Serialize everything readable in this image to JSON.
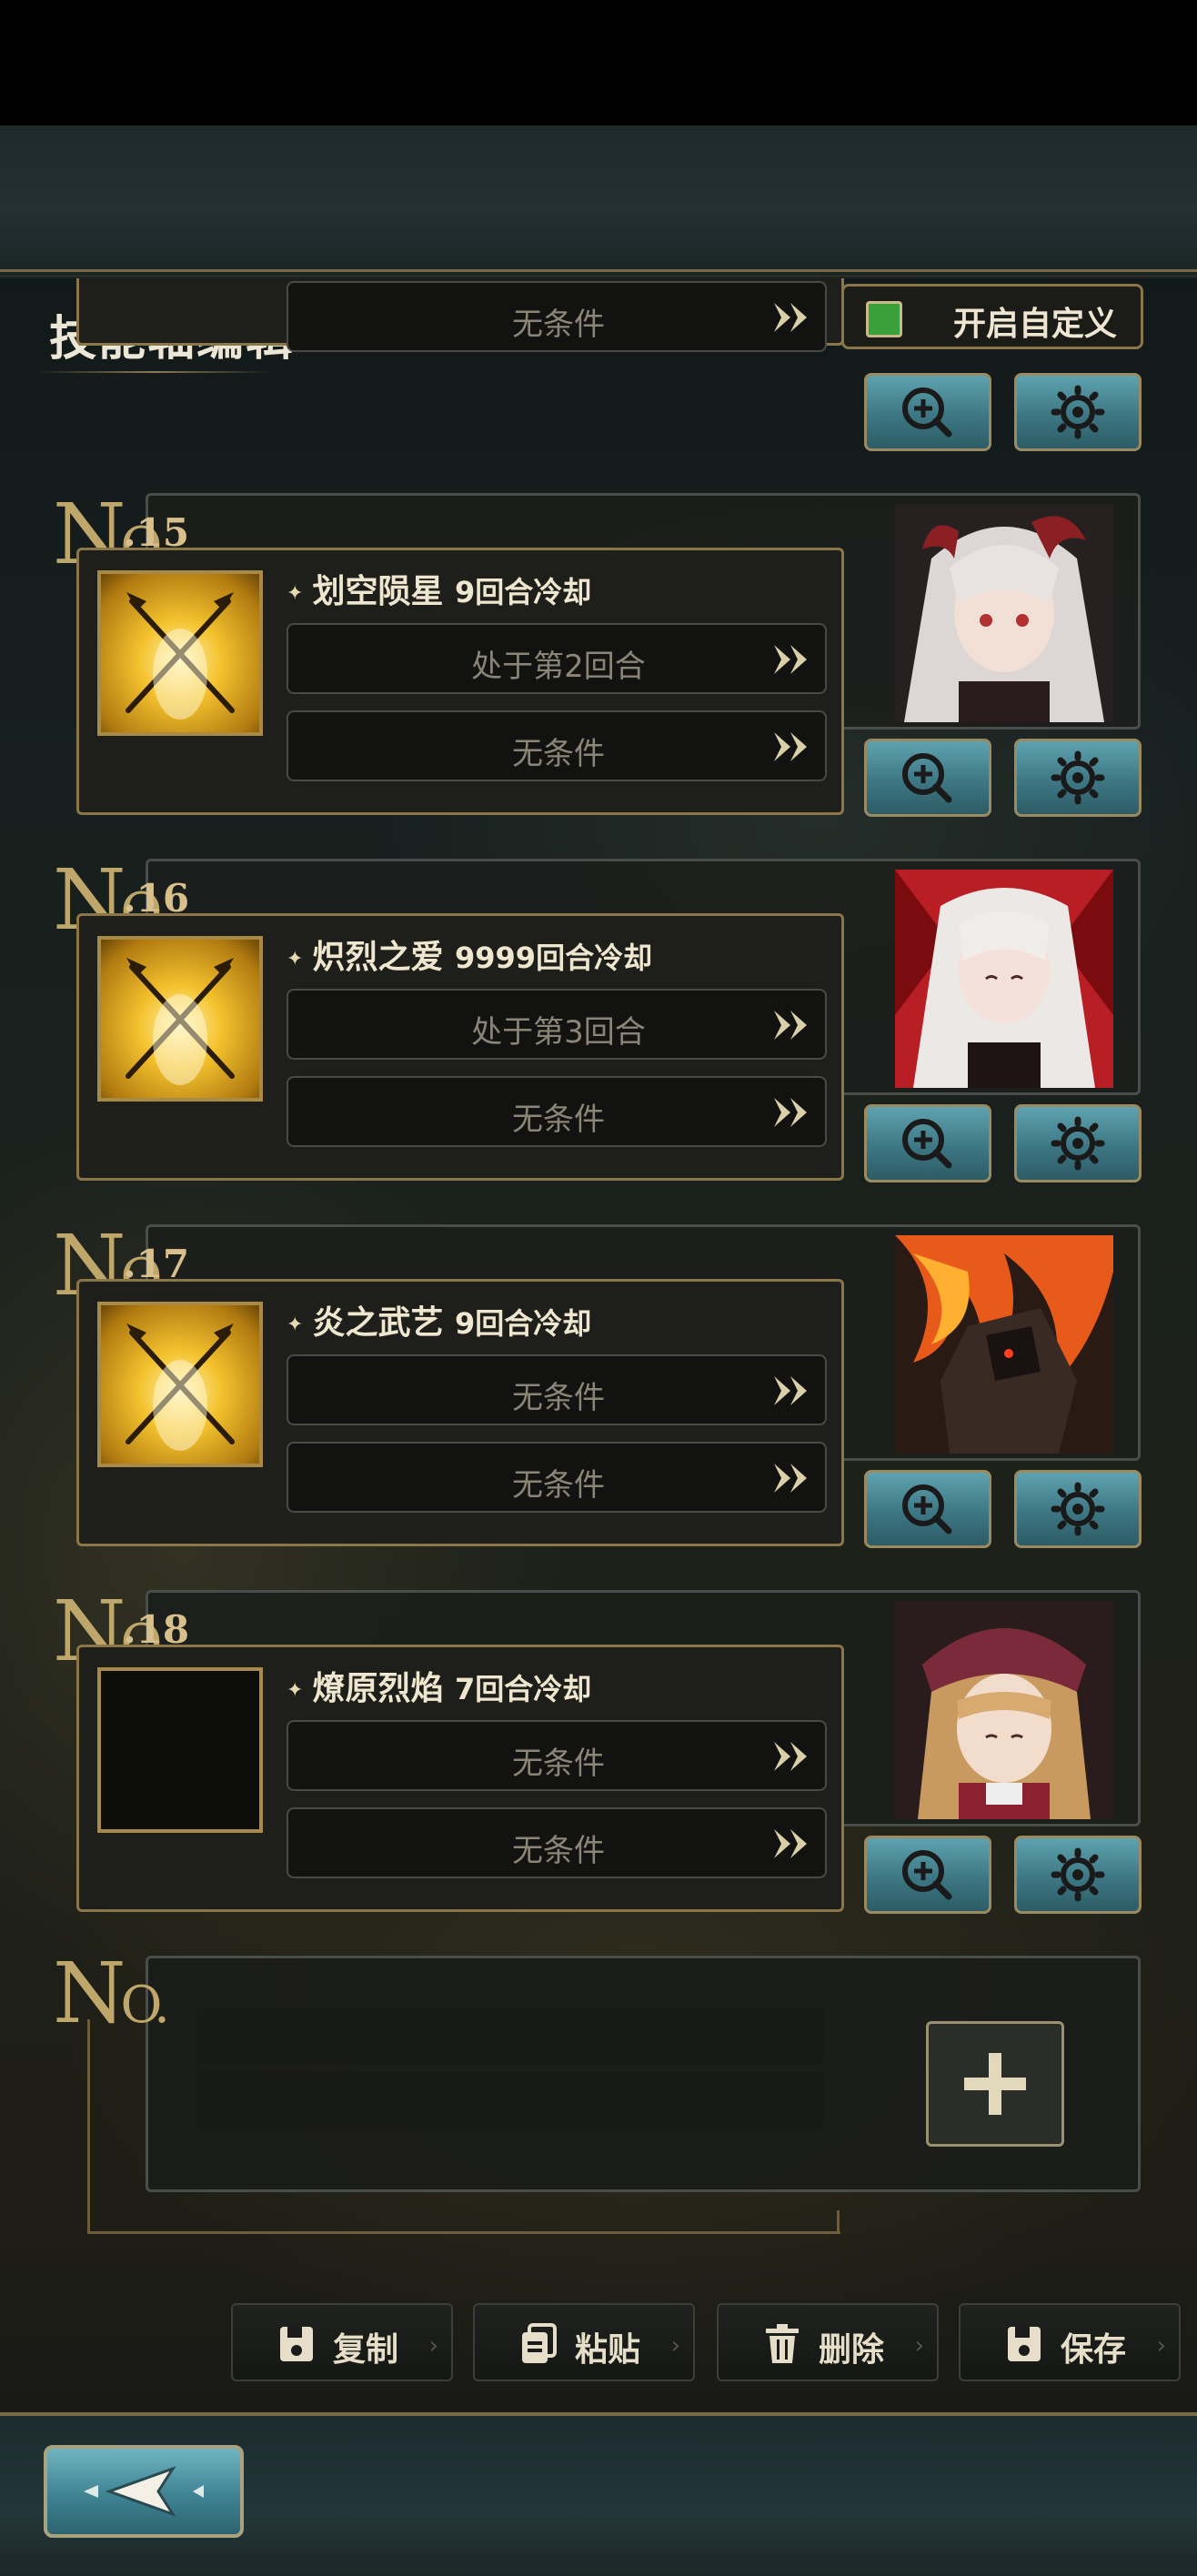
{
  "header": {
    "title": "技能轴编辑",
    "custom_toggle_label": "开启自定义",
    "custom_toggle_on": true
  },
  "colors": {
    "accent_gold": "#bfa66a",
    "toggle_green": "#3aa03a",
    "button_teal": "#3d7784"
  },
  "entries": [
    {
      "no": "",
      "skill": "",
      "conditions": [
        "无条件"
      ],
      "partial": true
    },
    {
      "no": ".15",
      "skill": "划空陨星",
      "cooldown": "9回合冷却",
      "conditions": [
        "处于第2回合",
        "无条件"
      ]
    },
    {
      "no": ".16",
      "skill": "炽烈之爱",
      "cooldown": "9999回合冷却",
      "conditions": [
        "处于第3回合",
        "无条件"
      ]
    },
    {
      "no": ".17",
      "skill": "炎之武艺",
      "cooldown": "9回合冷却",
      "conditions": [
        "无条件",
        "无条件"
      ]
    },
    {
      "no": ".18",
      "skill": "燎原烈焰",
      "cooldown": "7回合冷却",
      "conditions": [
        "无条件",
        "无条件"
      ]
    }
  ],
  "new_entry": {
    "no_label": "N",
    "no_suffix": "O."
  },
  "no_prefix": {
    "n": "N",
    "o": "O"
  },
  "actions": {
    "copy": "复制",
    "paste": "粘贴",
    "delete": "删除",
    "save": "保存"
  },
  "icons": {
    "zoom": "zoom-in-icon",
    "settings": "gear-icon",
    "add": "plus-icon",
    "back": "back-arrow-icon",
    "condition_arrow": "double-chevron-right-icon"
  }
}
